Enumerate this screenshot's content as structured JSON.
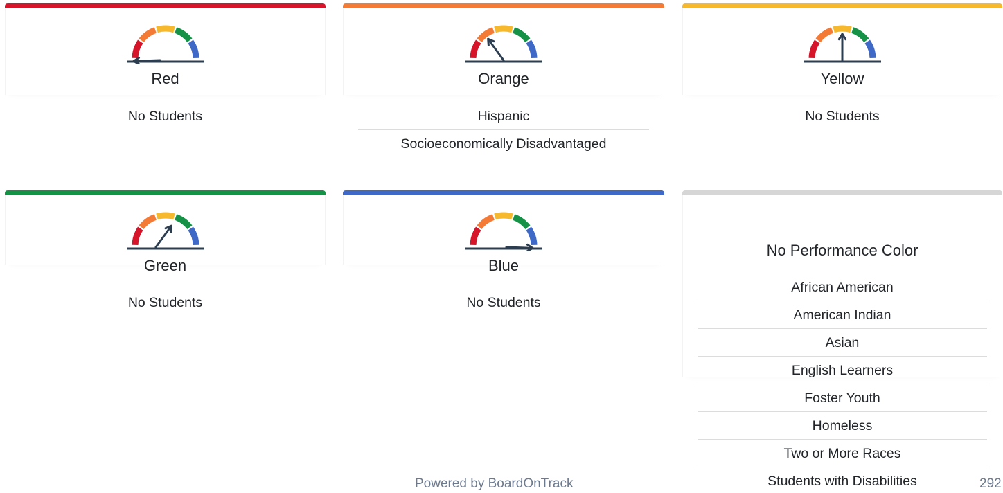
{
  "colors": {
    "red": "#d7152a",
    "orange": "#f47b35",
    "yellow": "#f6b92d",
    "green": "#169246",
    "blue": "#3f69c7",
    "gray": "#d6d6d6",
    "needle": "#2d3d50"
  },
  "cards": {
    "red": {
      "title": "Red",
      "groups": [
        "No Students"
      ],
      "level": 1
    },
    "orange": {
      "title": "Orange",
      "groups": [
        "Hispanic",
        "Socioeconomically Disadvantaged"
      ],
      "level": 2
    },
    "yellow": {
      "title": "Yellow",
      "groups": [
        "No Students"
      ],
      "level": 3
    },
    "green": {
      "title": "Green",
      "groups": [
        "No Students"
      ],
      "level": 4
    },
    "blue": {
      "title": "Blue",
      "groups": [
        "No Students"
      ],
      "level": 5
    },
    "none": {
      "title": "No Performance Color",
      "groups": [
        "African American",
        "American Indian",
        "Asian",
        "English Learners",
        "Foster Youth",
        "Homeless",
        "Two or More Races",
        "Students with Disabilities"
      ]
    }
  },
  "icons": {
    "gauge": "speedometer-gauge-icon"
  },
  "footer": {
    "text": "Powered by BoardOnTrack",
    "page_number": "292"
  }
}
